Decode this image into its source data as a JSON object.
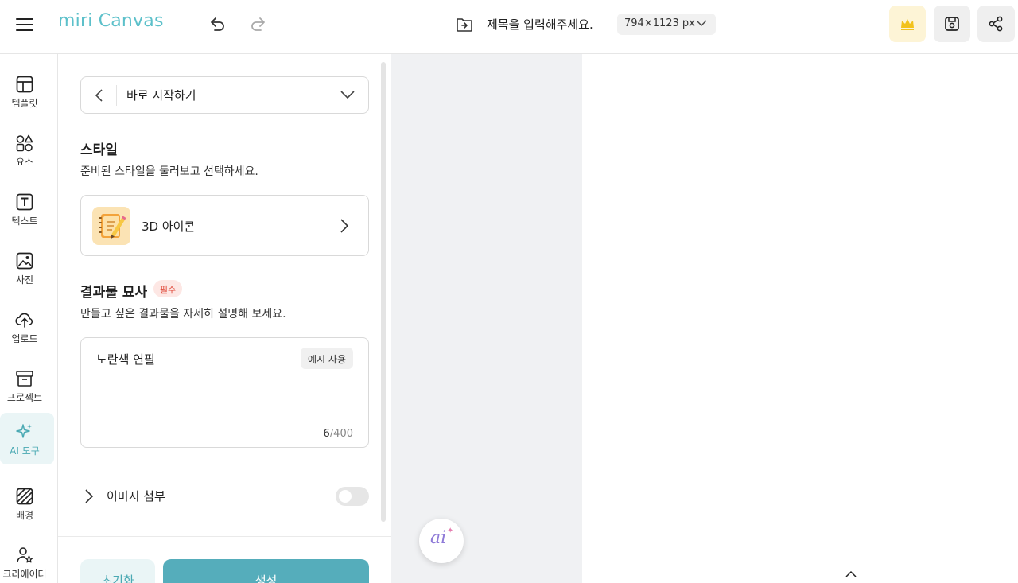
{
  "header": {
    "logo": "miri Canvas",
    "title_placeholder": "제목을 입력해주세요.",
    "size_label": "794×1123 px"
  },
  "sidebar": {
    "items": [
      {
        "label": "템플릿",
        "icon": "template-icon"
      },
      {
        "label": "요소",
        "icon": "elements-icon"
      },
      {
        "label": "텍스트",
        "icon": "text-icon"
      },
      {
        "label": "사진",
        "icon": "photo-icon"
      },
      {
        "label": "업로드",
        "icon": "upload-icon"
      },
      {
        "label": "프로젝트",
        "icon": "project-icon"
      },
      {
        "label": "AI 도구",
        "icon": "ai-tools-icon",
        "active": true
      },
      {
        "label": "배경",
        "icon": "background-icon"
      },
      {
        "label": "크리에이터",
        "icon": "creator-icon"
      }
    ]
  },
  "panel": {
    "dropdown_label": "바로 시작하기",
    "style": {
      "title": "스타일",
      "description": "준비된 스타일을 둘러보고 선택하세요.",
      "selected": "3D 아이콘"
    },
    "result": {
      "title": "결과물 묘사",
      "required_badge": "필수",
      "description": "만들고 싶은 결과물을 자세히 설명해 보세요.",
      "value": "노란색 연필",
      "example_button": "예시 사용",
      "count_current": "6",
      "count_max": "/400"
    },
    "attach": {
      "label": "이미지 첨부",
      "enabled": false
    },
    "reset_button": "초기화",
    "generate_button": "생성"
  },
  "canvas": {
    "ai_button": "ai"
  },
  "colors": {
    "brand": "#5cc0ca",
    "primary_button": "#55adbb",
    "required": "#e0493a"
  }
}
